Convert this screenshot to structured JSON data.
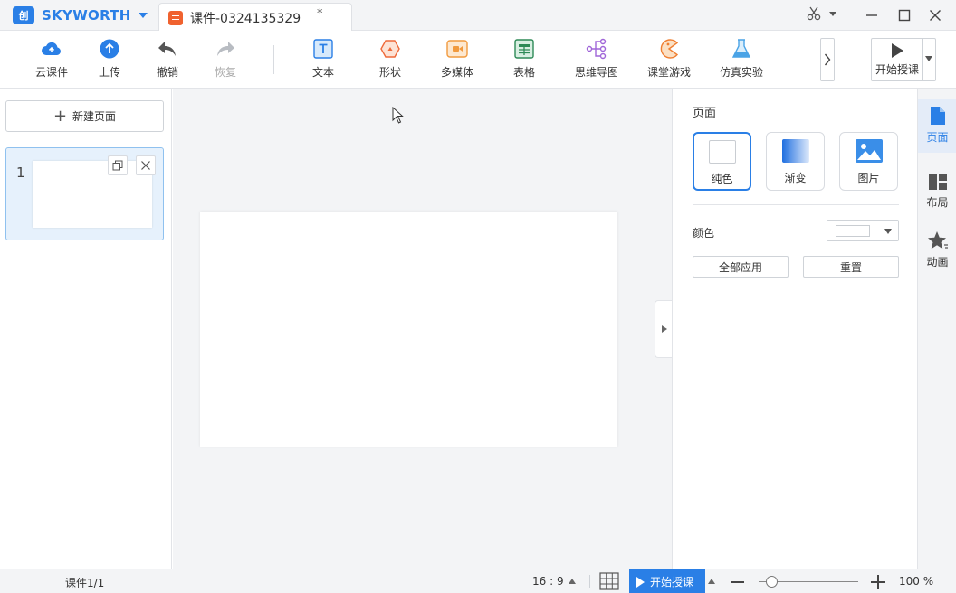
{
  "app": {
    "brand": "SKYWORTH",
    "brand_color": "#2a7fe6",
    "logo_glyph": "创"
  },
  "tab": {
    "title": "课件-0324135329",
    "modified_mark": "*"
  },
  "toolbar": {
    "cloud": "云课件",
    "upload": "上传",
    "undo": "撤销",
    "redo": "恢复",
    "text": "文本",
    "shape": "形状",
    "media": "多媒体",
    "table": "表格",
    "mindmap": "思维导图",
    "game": "课堂游戏",
    "lab": "仿真实验",
    "start": "开始授课"
  },
  "left": {
    "new_page": "新建页面",
    "thumbs": [
      {
        "num": "1"
      }
    ]
  },
  "right": {
    "section_title": "页面",
    "bg_options": {
      "solid": "纯色",
      "gradient": "渐变",
      "image": "图片"
    },
    "color_label": "颜色",
    "apply_all": "全部应用",
    "reset": "重置"
  },
  "sidetabs": {
    "page": "页面",
    "layout": "布局",
    "animation": "动画"
  },
  "status": {
    "pages": "课件1/1",
    "ratio": "16 : 9",
    "start": "开始授课",
    "zoom": "100 %"
  }
}
